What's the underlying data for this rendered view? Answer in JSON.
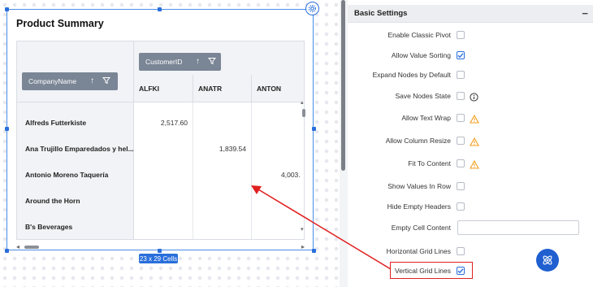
{
  "widget": {
    "title": "Product Summary",
    "column_field": "CustomerID",
    "row_field": "CompanyName",
    "columns": [
      "ALFKI",
      "ANATR",
      "ANTON"
    ],
    "rows": [
      {
        "name": "Alfreds Futterkiste",
        "values": [
          "2,517.60",
          "",
          ""
        ]
      },
      {
        "name": "Ana Trujillo Emparedados y hel...",
        "values": [
          "",
          "1,839.54",
          ""
        ]
      },
      {
        "name": "Antonio Moreno Taquería",
        "values": [
          "",
          "",
          "4,003."
        ]
      },
      {
        "name": "Around the Horn",
        "values": [
          "",
          "",
          ""
        ]
      },
      {
        "name": "B's Beverages",
        "values": [
          "",
          "",
          ""
        ]
      }
    ],
    "size_badge": "23 x 29 Cells"
  },
  "panel": {
    "section_title": "Basic Settings",
    "collapse_symbol": "−",
    "settings": [
      {
        "label": "Enable Classic Pivot",
        "checked": false,
        "extra": null
      },
      {
        "label": "Allow Value Sorting",
        "checked": true,
        "extra": null
      },
      {
        "label": "Expand Nodes by Default",
        "checked": false,
        "extra": null
      },
      {
        "label": "Save Nodes State",
        "checked": false,
        "extra": "info-icon"
      },
      {
        "label": "Allow Text Wrap",
        "checked": false,
        "extra": "warning-icon"
      },
      {
        "label": "Allow Column Resize",
        "checked": false,
        "extra": "warning-icon"
      },
      {
        "label": "Fit To Content",
        "checked": false,
        "extra": "warning-icon"
      },
      {
        "label": "Show Values In Row",
        "checked": false,
        "extra": null
      },
      {
        "label": "Hide Empty Headers",
        "checked": false,
        "extra": null
      },
      {
        "label": "Empty Cell Content",
        "checked": null,
        "extra": "textbox"
      },
      {
        "label": "Horizontal Grid Lines",
        "checked": false,
        "extra": null
      },
      {
        "label": "Vertical Grid Lines",
        "checked": true,
        "extra": null
      }
    ],
    "empty_cell_value": ""
  },
  "colors": {
    "accent": "#2a6fdb",
    "chip": "#7a8595",
    "warning": "#f0a020",
    "highlight": "#e02020"
  }
}
